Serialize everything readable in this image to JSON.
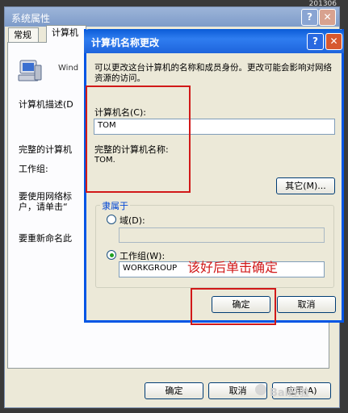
{
  "desktop": {
    "date_text": "201306"
  },
  "bg_window": {
    "title": "系统属性",
    "help_icon": "?",
    "close_icon": "✕",
    "tabs": [
      "常规",
      "计算机"
    ],
    "product_text": "Wind",
    "desc_label": "计算机描述(D",
    "full_name_label": "完整的计算机",
    "workgroup_label": "工作组:",
    "network_text_1": "要使用网络标",
    "network_text_2": "户，请单击“",
    "rename_text": "要重新命名此",
    "buttons": {
      "ok": "确定",
      "cancel": "取消",
      "apply": "应用(A)"
    }
  },
  "dialog": {
    "title": "计算机名称更改",
    "help_icon": "?",
    "close_icon": "✕",
    "intro": "可以更改这台计算机的名称和成员身份。更改可能会影响对网络资源的访问。",
    "computer_name_label": "计算机名(C):",
    "computer_name_value": "TOM",
    "full_name_label": "完整的计算机名称:",
    "full_name_value": "TOM.",
    "other_button": "其它(M)...",
    "member_of_legend": "隶属于",
    "domain_label": "域(D):",
    "domain_value": "",
    "workgroup_label": "工作组(W):",
    "workgroup_value": "WORKGROUP",
    "selected_option": "workgroup",
    "ok_button": "确定",
    "cancel_button": "取消"
  },
  "annotation": {
    "text": "该好后单击确定",
    "color": "#d11919"
  },
  "watermark": {
    "text": "Bai经验"
  }
}
